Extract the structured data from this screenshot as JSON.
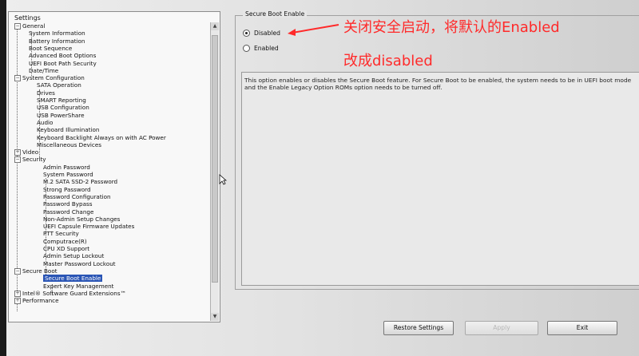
{
  "tree": {
    "title": "Settings",
    "items": [
      {
        "label": "General",
        "level": 0,
        "expander": "−"
      },
      {
        "label": "System Information",
        "level": 1
      },
      {
        "label": "Battery Information",
        "level": 1
      },
      {
        "label": "Boot Sequence",
        "level": 1
      },
      {
        "label": "Advanced Boot Options",
        "level": 1
      },
      {
        "label": "UEFI Boot Path Security",
        "level": 1
      },
      {
        "label": "Date/Time",
        "level": 1
      },
      {
        "label": "System Configuration",
        "level": 0,
        "expander": "−"
      },
      {
        "label": "SATA Operation",
        "level": 2
      },
      {
        "label": "Drives",
        "level": 2
      },
      {
        "label": "SMART Reporting",
        "level": 2
      },
      {
        "label": "USB Configuration",
        "level": 2
      },
      {
        "label": "USB PowerShare",
        "level": 2
      },
      {
        "label": "Audio",
        "level": 2
      },
      {
        "label": "Keyboard Illumination",
        "level": 2
      },
      {
        "label": "Keyboard Backlight Always on with AC Power",
        "level": 2
      },
      {
        "label": "Miscellaneous Devices",
        "level": 2
      },
      {
        "label": "Video",
        "level": 0,
        "expander": "+"
      },
      {
        "label": "Security",
        "level": 0,
        "expander": "−"
      },
      {
        "label": "Admin Password",
        "level": 3
      },
      {
        "label": "System Password",
        "level": 3
      },
      {
        "label": "M.2 SATA SSD-2 Password",
        "level": 3
      },
      {
        "label": "Strong Password",
        "level": 3
      },
      {
        "label": "Password Configuration",
        "level": 3
      },
      {
        "label": "Password Bypass",
        "level": 3
      },
      {
        "label": "Password Change",
        "level": 3
      },
      {
        "label": "Non-Admin Setup Changes",
        "level": 3
      },
      {
        "label": "UEFI Capsule Firmware Updates",
        "level": 3
      },
      {
        "label": "PTT Security",
        "level": 3
      },
      {
        "label": "Computrace(R)",
        "level": 3
      },
      {
        "label": "CPU XD Support",
        "level": 3
      },
      {
        "label": "Admin Setup Lockout",
        "level": 3
      },
      {
        "label": "Master Password Lockout",
        "level": 3
      },
      {
        "label": "Secure Boot",
        "level": 0,
        "expander": "−"
      },
      {
        "label": "Secure Boot Enable",
        "level": 3,
        "selected": true
      },
      {
        "label": "Expert Key Management",
        "level": 3
      },
      {
        "label": "Intel® Software Guard Extensions™",
        "level": 0,
        "expander": "+"
      },
      {
        "label": "Performance",
        "level": 0,
        "expander": "+"
      }
    ]
  },
  "group": {
    "title": "Secure Boot Enable",
    "options": [
      {
        "label": "Disabled",
        "selected": true
      },
      {
        "label": "Enabled",
        "selected": false
      }
    ],
    "description": "This option enables or disables the Secure Boot feature. For Secure Boot to be enabled, the system needs to be in UEFI boot mode and the Enable Legacy Option ROMs option needs to be turned off."
  },
  "annotation": {
    "line1": "关闭安全启动，将默认的Enabled",
    "line2": "改成disabled",
    "color": "#ff2a2a"
  },
  "buttons": {
    "restore": "Restore Settings",
    "apply": "Apply",
    "exit": "Exit"
  },
  "colors": {
    "selection": "#2a55b5",
    "background": "#e6e6e6"
  }
}
